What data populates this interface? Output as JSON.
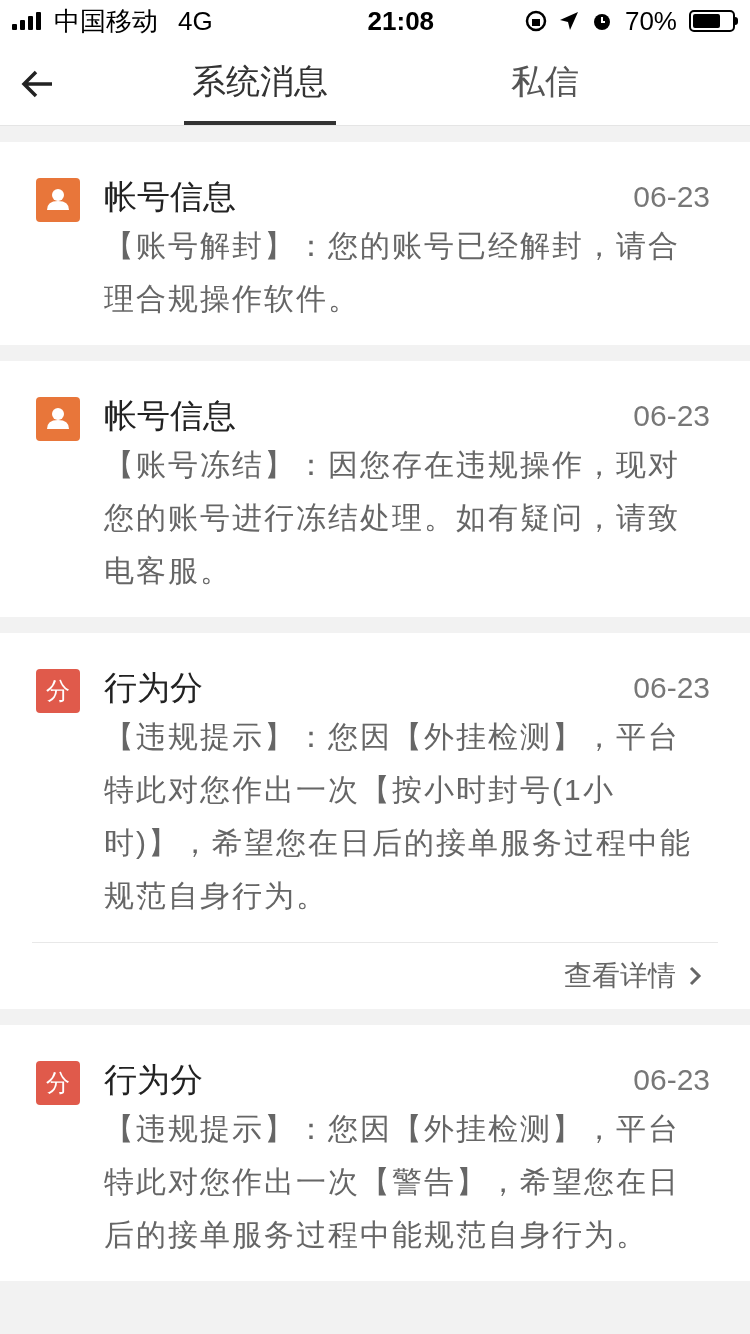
{
  "status_bar": {
    "carrier": "中国移动",
    "network": "4G",
    "time": "21:08",
    "battery": "70%"
  },
  "tabs": [
    {
      "label": "系统消息",
      "selected": true
    },
    {
      "label": "私信",
      "selected": false
    }
  ],
  "messages": [
    {
      "kind": "person",
      "title": "帐号信息",
      "date": "06-23",
      "body": "【账号解封】：您的账号已经解封，请合理合规操作软件。"
    },
    {
      "kind": "person",
      "title": "帐号信息",
      "date": "06-23",
      "body": "【账号冻结】：因您存在违规操作，现对您的账号进行冻结处理。如有疑问，请致电客服。"
    },
    {
      "kind": "text",
      "badge": "分",
      "title": "行为分",
      "date": "06-23",
      "body": "【违规提示】：您因【外挂检测】，平台特此对您作出一次【按小时封号(1小时)】，希望您在日后的接单服务过程中能规范自身行为。",
      "link": "查看详情"
    },
    {
      "kind": "text",
      "badge": "分",
      "title": "行为分",
      "date": "06-23",
      "body": "【违规提示】：您因【外挂检测】，平台特此对您作出一次【警告】，希望您在日后的接单服务过程中能规范自身行为。"
    }
  ]
}
